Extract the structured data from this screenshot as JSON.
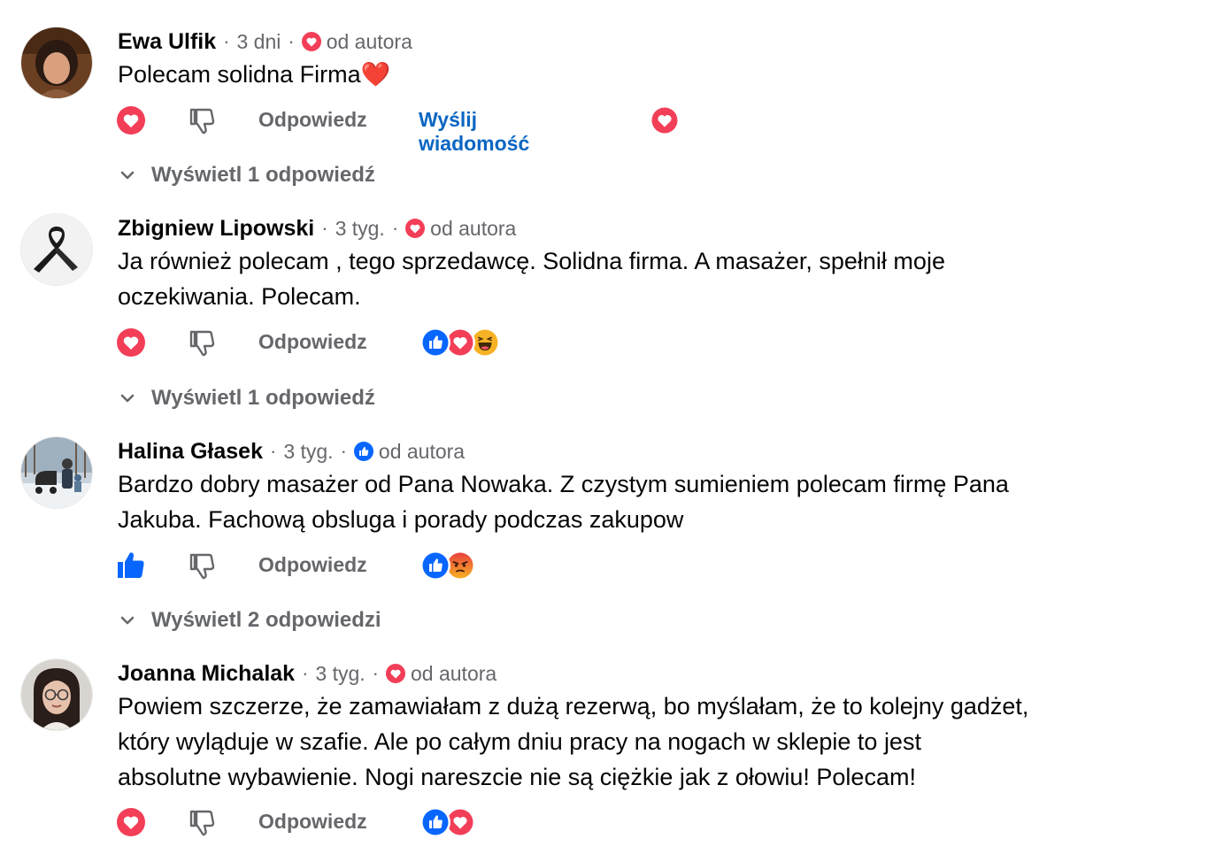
{
  "labels": {
    "separator": "·",
    "from_author": "od autora",
    "reply": "Odpowiedz",
    "send_message": "Wyślij wiadomość"
  },
  "comments": [
    {
      "author": "Ewa Ulfik",
      "time": "3 dni",
      "author_reaction": "love",
      "text_lines": [
        "Polecam solidna Firma❤️"
      ],
      "my_reaction": "love",
      "reaction_summary": [
        "love"
      ],
      "replies_label": "Wyświetl 1 odpowiedź"
    },
    {
      "author": "Zbigniew Lipowski",
      "time": "3 tyg.",
      "author_reaction": "love",
      "text_lines": [
        "Ja również polecam , tego sprzedawcę. Solidna firma. A masażer, spełnił moje",
        "oczekiwania. Polecam."
      ],
      "my_reaction": "love",
      "reaction_summary": [
        "like",
        "love",
        "haha"
      ],
      "replies_label": "Wyświetl 1 odpowiedź"
    },
    {
      "author": "Halina Głasek",
      "time": "3 tyg.",
      "author_reaction": "like",
      "text_lines": [
        "Bardzo dobry masażer od Pana Nowaka. Z czystym sumieniem polecam firmę Pana",
        "Jakuba. Fachową obsluga i porady podczas zakupow"
      ],
      "my_reaction": "like",
      "reaction_summary": [
        "like",
        "angry"
      ],
      "replies_label": "Wyświetl 2 odpowiedzi"
    },
    {
      "author": "Joanna Michalak",
      "time": "3 tyg.",
      "author_reaction": "love",
      "text_lines": [
        "Powiem szczerze, że zamawiałam z dużą rezerwą, bo myślałam, że to kolejny gadżet,",
        "który wyląduje w szafie. Ale po całym dniu pracy na nogach w sklepie to jest",
        "absolutne wybawienie. Nogi nareszcie nie są ciężkie jak z ołowiu! Polecam!"
      ],
      "my_reaction": "love",
      "reaction_summary": [
        "like",
        "love"
      ],
      "replies_label": ""
    }
  ],
  "colors": {
    "love": "#f33e58",
    "like": "#0866ff",
    "haha": "#f7b125",
    "angry": "#e9710f",
    "muted_text": "#65676b",
    "link": "#0a66c2"
  }
}
